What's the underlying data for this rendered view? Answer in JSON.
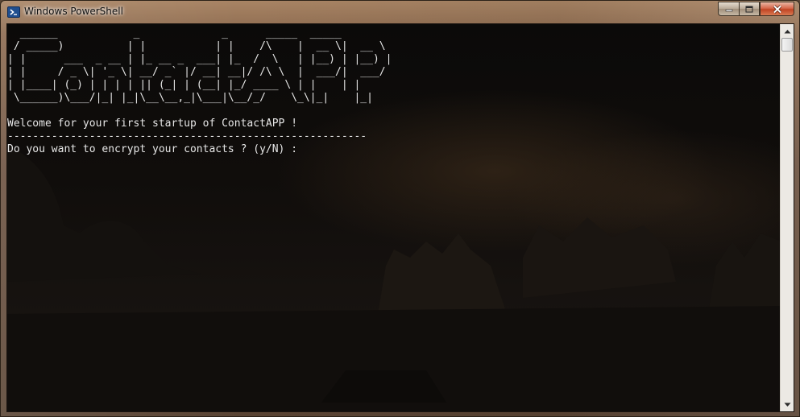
{
  "window": {
    "title": "Windows PowerShell",
    "icon": "powershell-icon"
  },
  "caption_buttons": {
    "minimize_icon": "minimize-icon",
    "maximize_icon": "maximize-icon",
    "close_icon": "close-icon"
  },
  "console": {
    "lines": [
      "  ______            _             _      _____  _____",
      " / _____)          | |           | |    /\\    |  __ \\|  __ \\",
      "| |      ___  _ __ | |_ __ _  ___| |_  /  \\   | |__) | |__) |",
      "| |     / _ \\| '_ \\| __/ _` |/ __| __|/ /\\ \\  |  ___/|  ___/",
      "| |____| (_) | | | | || (_| | (__| |_/ ____ \\ | |    | |",
      " \\______)\\___/|_| |_|\\__\\__,_|\\___|\\__/_/    \\_\\|_|    |_|",
      "",
      "Welcome for your first startup of ContactAPP !",
      "---------------------------------------------------------",
      "Do you want to encrypt your contacts ? (y/N) :"
    ]
  },
  "colors": {
    "console_text": "#e6e6e6",
    "console_background": "#100d0b",
    "close_button": "#c14524"
  },
  "scrollbar": {
    "up_icon": "scroll-up-arrow-icon",
    "down_icon": "scroll-down-arrow-icon"
  }
}
